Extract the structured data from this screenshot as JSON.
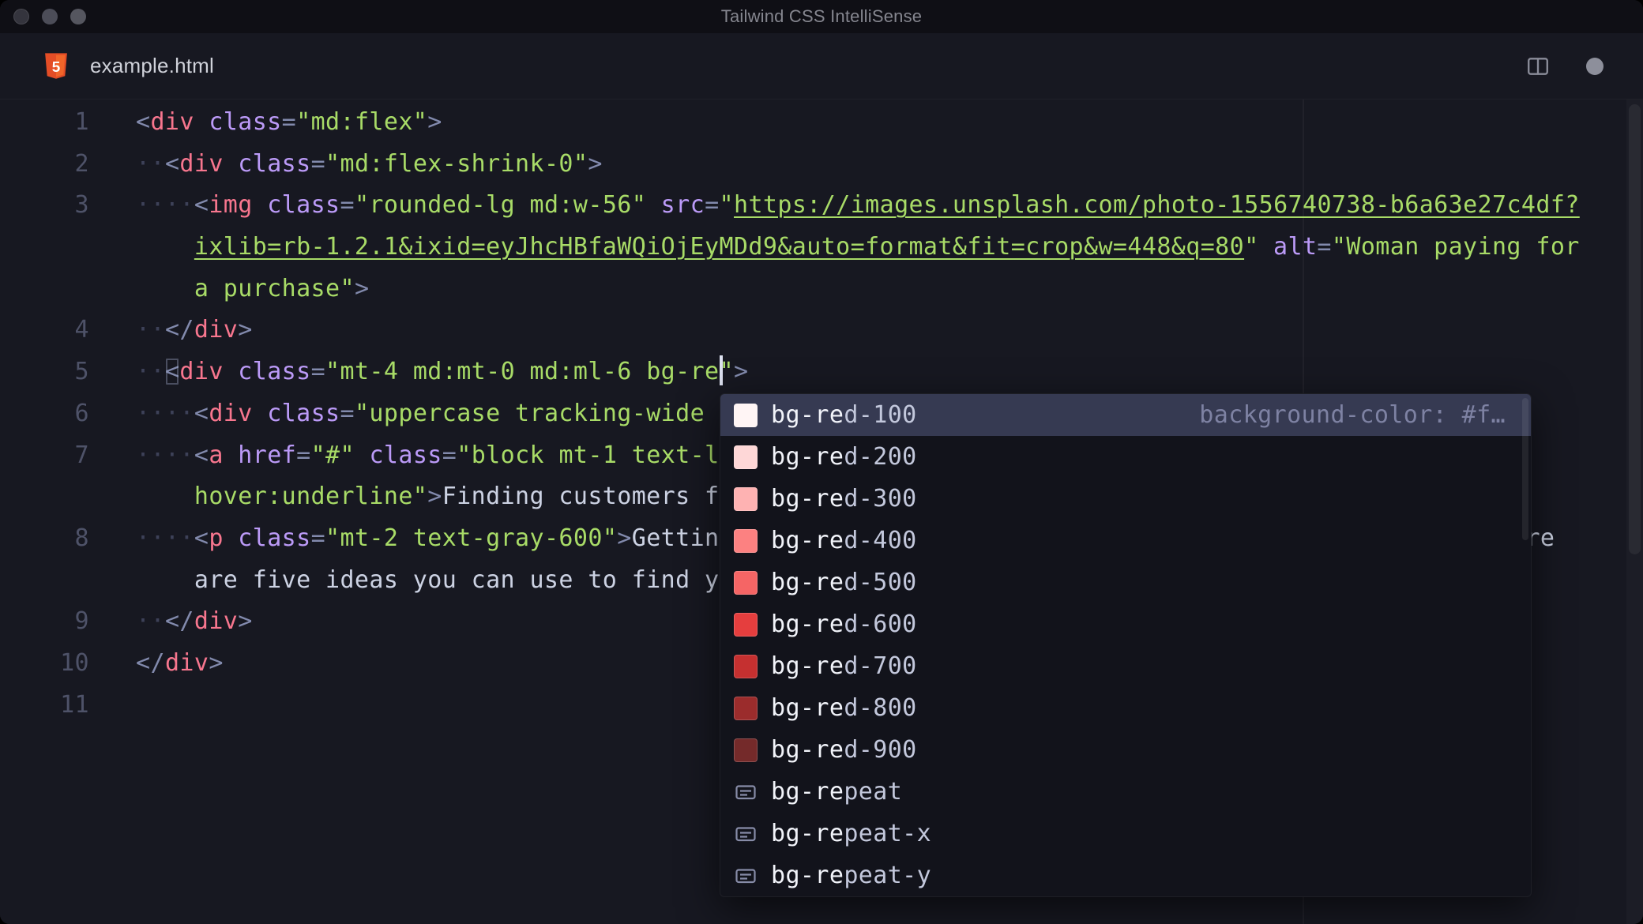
{
  "window": {
    "title": "Tailwind CSS IntelliSense"
  },
  "tab_bar": {
    "filename": "example.html"
  },
  "editor": {
    "lines": [
      {
        "num": "1",
        "tokens": [
          [
            "p",
            "<"
          ],
          [
            "t",
            "div"
          ],
          [
            "sp",
            " "
          ],
          [
            "at",
            "class"
          ],
          [
            "p",
            "="
          ],
          [
            "s",
            "\"md:flex\""
          ],
          [
            "p",
            ">"
          ]
        ]
      },
      {
        "num": "2",
        "tokens": [
          [
            "ws",
            "··"
          ],
          [
            "p",
            "<"
          ],
          [
            "t",
            "div"
          ],
          [
            "sp",
            " "
          ],
          [
            "at",
            "class"
          ],
          [
            "p",
            "="
          ],
          [
            "s",
            "\"md:flex-shrink-0\""
          ],
          [
            "p",
            ">"
          ]
        ]
      },
      {
        "num": "3",
        "tokens": [
          [
            "ws",
            "····"
          ],
          [
            "p",
            "<"
          ],
          [
            "t",
            "img"
          ],
          [
            "sp",
            " "
          ],
          [
            "at",
            "class"
          ],
          [
            "p",
            "="
          ],
          [
            "s",
            "\"rounded-lg md:w-56\""
          ],
          [
            "sp",
            " "
          ],
          [
            "at",
            "src"
          ],
          [
            "p",
            "="
          ],
          [
            "s",
            "\""
          ],
          [
            "u",
            "https://images.unsplash.com/photo-1556740738-b6a63e27c4df?"
          ]
        ]
      },
      {
        "num": "",
        "tokens": [
          [
            "sp",
            "    "
          ],
          [
            "u",
            "ixlib=rb-1.2.1&ixid=eyJhcHBfaWQiOjEyMDd9&auto=format&fit=crop&w=448&q=80"
          ],
          [
            "s",
            "\""
          ],
          [
            "sp",
            " "
          ],
          [
            "at",
            "alt"
          ],
          [
            "p",
            "="
          ],
          [
            "s",
            "\"Woman paying for"
          ]
        ]
      },
      {
        "num": "",
        "tokens": [
          [
            "sp",
            "    "
          ],
          [
            "s",
            "a purchase\""
          ],
          [
            "p",
            ">"
          ]
        ]
      },
      {
        "num": "4",
        "tokens": [
          [
            "ws",
            "··"
          ],
          [
            "p",
            "</"
          ],
          [
            "t",
            "div"
          ],
          [
            "p",
            ">"
          ]
        ]
      },
      {
        "num": "5",
        "tokens": [
          [
            "ws",
            "··"
          ],
          [
            "pb",
            "<"
          ],
          [
            "t",
            "div"
          ],
          [
            "sp",
            " "
          ],
          [
            "at",
            "class"
          ],
          [
            "p",
            "="
          ],
          [
            "s",
            "\"mt-4 md:mt-0 md:ml-6 bg-re"
          ],
          [
            "cur",
            ""
          ],
          [
            "s",
            "\""
          ],
          [
            "p",
            ">"
          ]
        ]
      },
      {
        "num": "6",
        "tokens": [
          [
            "ws",
            "····"
          ],
          [
            "p",
            "<"
          ],
          [
            "t",
            "div"
          ],
          [
            "sp",
            " "
          ],
          [
            "at",
            "class"
          ],
          [
            "p",
            "="
          ],
          [
            "s",
            "\"uppercase tracking-wide"
          ]
        ]
      },
      {
        "num": "7",
        "tokens": [
          [
            "ws",
            "····"
          ],
          [
            "p",
            "<"
          ],
          [
            "t",
            "a"
          ],
          [
            "sp",
            " "
          ],
          [
            "at",
            "href"
          ],
          [
            "p",
            "="
          ],
          [
            "s",
            "\"#\""
          ],
          [
            "sp",
            " "
          ],
          [
            "at",
            "class"
          ],
          [
            "p",
            "="
          ],
          [
            "s",
            "\"block mt-1 text-l"
          ]
        ]
      },
      {
        "num": "",
        "tokens": [
          [
            "sp",
            "    "
          ],
          [
            "s",
            "hover:underline\""
          ],
          [
            "p",
            ">"
          ],
          [
            "w",
            "Finding customers f"
          ]
        ]
      },
      {
        "num": "8",
        "tokens": [
          [
            "ws",
            "····"
          ],
          [
            "p",
            "<"
          ],
          [
            "t",
            "p"
          ],
          [
            "sp",
            " "
          ],
          [
            "at",
            "class"
          ],
          [
            "p",
            "="
          ],
          [
            "s",
            "\"mt-2 text-gray-600\""
          ],
          [
            "p",
            ">"
          ],
          [
            "w",
            "Gettin"
          ],
          [
            "abs",
            "ere",
            1800
          ]
        ]
      },
      {
        "num": "",
        "tokens": [
          [
            "sp",
            "    "
          ],
          [
            "w",
            "are five ideas you can use to find y"
          ]
        ]
      },
      {
        "num": "9",
        "tokens": [
          [
            "ws",
            "··"
          ],
          [
            "p",
            "</"
          ],
          [
            "t",
            "div"
          ],
          [
            "p",
            ">"
          ]
        ]
      },
      {
        "num": "10",
        "tokens": [
          [
            "p",
            "</"
          ],
          [
            "t",
            "div"
          ],
          [
            "p",
            ">"
          ]
        ]
      },
      {
        "num": "11",
        "tokens": []
      }
    ]
  },
  "popup": {
    "match_prefix": "bg-re",
    "items": [
      {
        "icon": "swatch",
        "color": "#fff5f5",
        "label": "bg-red-100",
        "detail": "background-color: #f…",
        "selected": true
      },
      {
        "icon": "swatch",
        "color": "#fed7d7",
        "label": "bg-red-200"
      },
      {
        "icon": "swatch",
        "color": "#feb2b2",
        "label": "bg-red-300"
      },
      {
        "icon": "swatch",
        "color": "#fc8181",
        "label": "bg-red-400"
      },
      {
        "icon": "swatch",
        "color": "#f56565",
        "label": "bg-red-500"
      },
      {
        "icon": "swatch",
        "color": "#e53e3e",
        "label": "bg-red-600"
      },
      {
        "icon": "swatch",
        "color": "#c53030",
        "label": "bg-red-700"
      },
      {
        "icon": "swatch",
        "color": "#9b2c2c",
        "label": "bg-red-800"
      },
      {
        "icon": "swatch",
        "color": "#742a2a",
        "label": "bg-red-900"
      },
      {
        "icon": "field",
        "label": "bg-repeat"
      },
      {
        "icon": "field",
        "label": "bg-repeat-x"
      },
      {
        "icon": "field",
        "label": "bg-repeat-y"
      }
    ]
  },
  "colors": {
    "editor_background": "#171821",
    "titlebar_background": "#0f0f15",
    "popup_background": "#12131b",
    "popup_selected": "#363a52",
    "tag": "#f7768e",
    "attribute": "#bb9af7",
    "string": "#a8db67",
    "html5_logo": "#e44d26"
  }
}
